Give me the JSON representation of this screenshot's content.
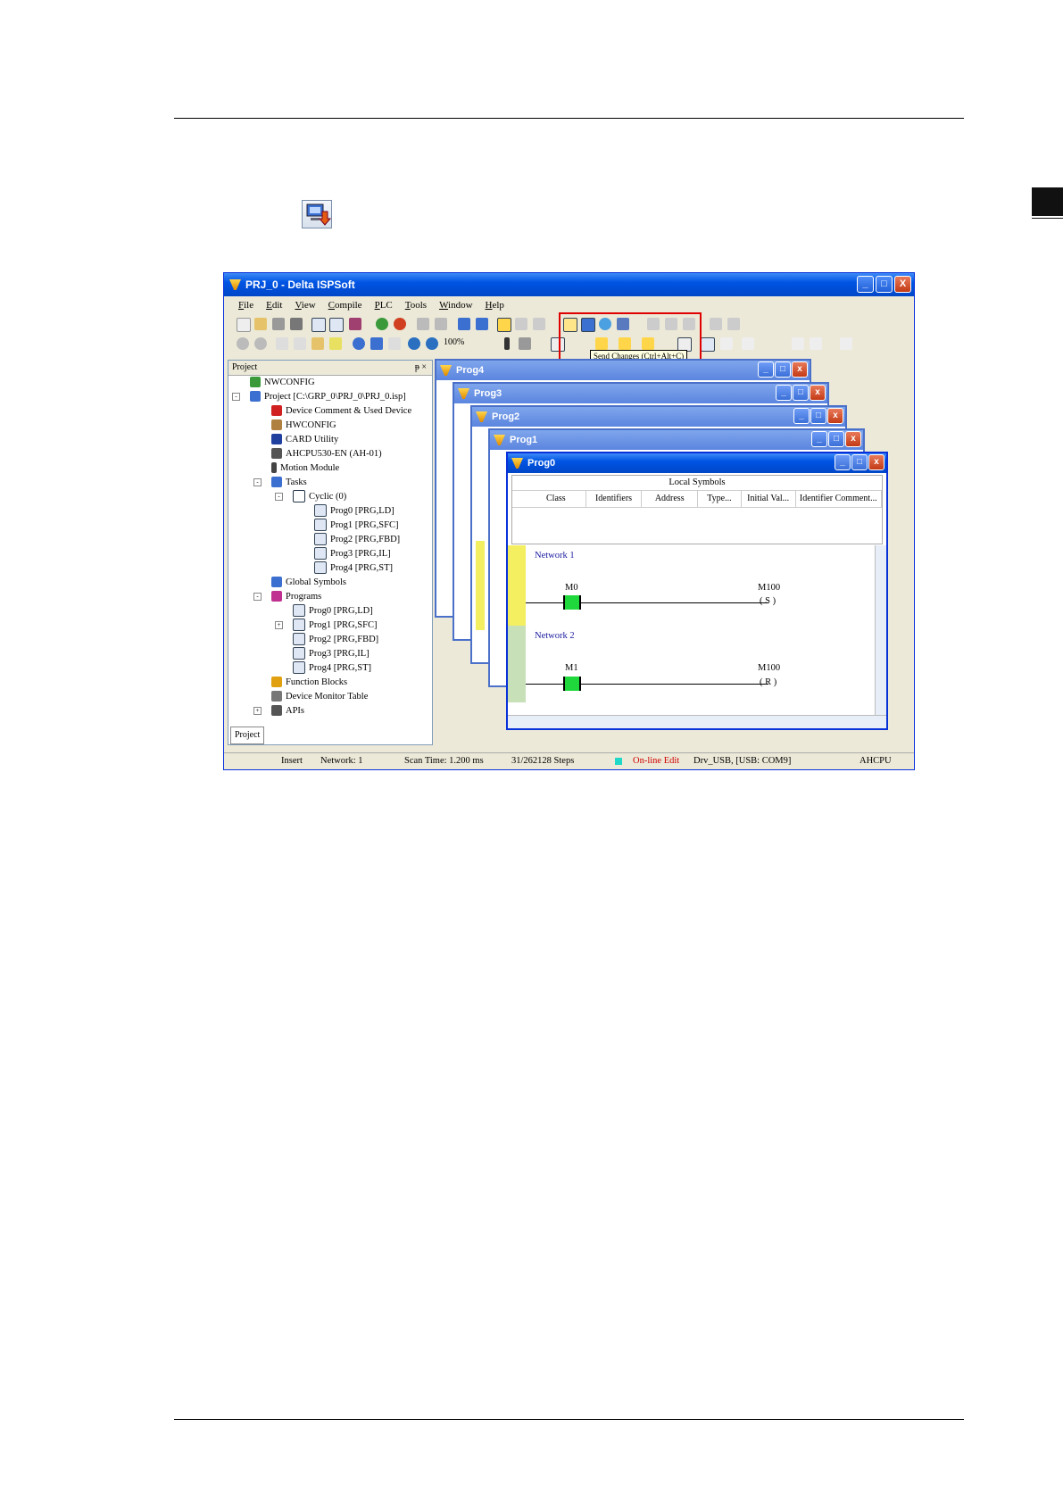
{
  "window": {
    "title": "PRJ_0 - Delta ISPSoft",
    "controls": [
      "_",
      "□",
      "X"
    ]
  },
  "menu": [
    "File",
    "Edit",
    "View",
    "Compile",
    "PLC",
    "Tools",
    "Window",
    "Help"
  ],
  "toolbar": {
    "zoom": "100%",
    "tooltip": "Send Changes (Ctrl+Alt+C)"
  },
  "project_panel": {
    "header": "Project",
    "pin": "ᵽ ×",
    "bottom_tab": "Project",
    "tree": [
      {
        "label": "NWCONFIG"
      },
      {
        "label": "Project [C:\\GRP_0\\PRJ_0\\PRJ_0.isp]"
      },
      {
        "label": "Device Comment & Used Device"
      },
      {
        "label": "HWCONFIG"
      },
      {
        "label": "CARD Utility"
      },
      {
        "label": "AHCPU530-EN  (AH-01)"
      },
      {
        "label": "Motion Module"
      },
      {
        "label": "Tasks"
      },
      {
        "label": "Cyclic (0)"
      },
      {
        "label": "Prog0 [PRG,LD]"
      },
      {
        "label": "Prog1 [PRG,SFC]"
      },
      {
        "label": "Prog2 [PRG,FBD]"
      },
      {
        "label": "Prog3 [PRG,IL]"
      },
      {
        "label": "Prog4 [PRG,ST]"
      },
      {
        "label": "Global Symbols"
      },
      {
        "label": "Programs"
      },
      {
        "label": "Prog0 [PRG,LD]"
      },
      {
        "label": "Prog1 [PRG,SFC]"
      },
      {
        "label": "Prog2 [PRG,FBD]"
      },
      {
        "label": "Prog3 [PRG,IL]"
      },
      {
        "label": "Prog4 [PRG,ST]"
      },
      {
        "label": "Function Blocks"
      },
      {
        "label": "Device Monitor Table"
      },
      {
        "label": "APIs"
      }
    ]
  },
  "child_windows": [
    "Prog4",
    "Prog3",
    "Prog2",
    "Prog1",
    "Prog0"
  ],
  "prog0": {
    "local_symbols_title": "Local Symbols",
    "columns": [
      "Class",
      "Identifiers",
      "Address",
      "Type...",
      "Initial Val...",
      "Identifier Comment..."
    ],
    "networks": [
      {
        "label": "Network 1",
        "contact": "M0",
        "coil": "M100",
        "coil_type": "S"
      },
      {
        "label": "Network 2",
        "contact": "M1",
        "coil": "M100",
        "coil_type": "R"
      }
    ]
  },
  "status_bar": {
    "mode": "Insert",
    "network": "Network: 1",
    "scan_time": "Scan Time: 1.200 ms",
    "steps": "31/262128 Steps",
    "online_edit": "On-line Edit",
    "driver": "Drv_USB, [USB: COM9]",
    "cpu": "AHCPU"
  },
  "colors": {
    "title_active": "#0054e3",
    "contact_green": "#1fd83b",
    "highlight_red": "#e00000"
  }
}
